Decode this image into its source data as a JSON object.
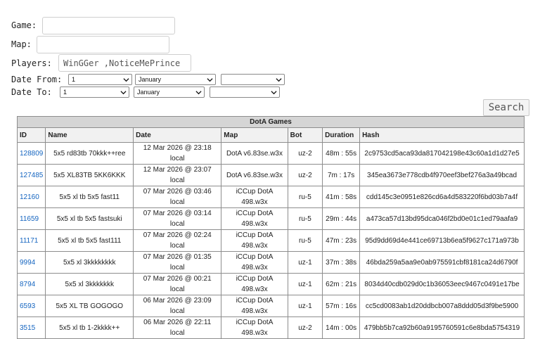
{
  "form": {
    "game_label": "Game:",
    "map_label": "Map:",
    "players_label": "Players:",
    "players_value": "WinGGer ,NoticeMePrince",
    "date_from_label": "Date From:",
    "date_to_label": "Date To:",
    "from_day": "1",
    "from_month": "January",
    "from_year": "",
    "to_day": "1",
    "to_month": "January",
    "to_year": "",
    "search_label": "Search"
  },
  "table": {
    "caption": "DotA Games",
    "headers": [
      "ID",
      "Name",
      "Date",
      "Map",
      "Bot",
      "Duration",
      "Hash"
    ],
    "rows": [
      {
        "id": "128809",
        "name": "5x5 rd83tb 70kkk++ree",
        "date": "12 Mar 2026 @ 23:18 local",
        "map": "DotA v6.83se.w3x",
        "bot": "uz-2",
        "duration": "48m : 55s",
        "hash": "2c9753cd5aca93da817042198e43c60a1d1d27e5"
      },
      {
        "id": "127485",
        "name": "5x5 XL83TB 5KK6KKK",
        "date": "12 Mar 2026 @ 23:07 local",
        "map": "DotA v6.83se.w3x",
        "bot": "uz-2",
        "duration": "7m : 17s",
        "hash": "345ea3673e778cdb4f970eef3bef276a3a49bcad"
      },
      {
        "id": "12160",
        "name": "5x5 xl tb 5x5 fast11",
        "date": "07 Mar 2026 @ 03:46 local",
        "map": "iCCup DotA 498.w3x",
        "bot": "ru-5",
        "duration": "41m : 58s",
        "hash": "cdd145c3e0951e826cd6a4d583220f6bd03b7a4f"
      },
      {
        "id": "11659",
        "name": "5x5 xl tb 5x5 fastsuki",
        "date": "07 Mar 2026 @ 03:14 local",
        "map": "iCCup DotA 498.w3x",
        "bot": "ru-5",
        "duration": "29m : 44s",
        "hash": "a473ca57d13bd95dca046f2bd0e01c1ed79aafa9"
      },
      {
        "id": "11171",
        "name": "5x5 xl tb 5x5 fast111",
        "date": "07 Mar 2026 @ 02:24 local",
        "map": "iCCup DotA 498.w3x",
        "bot": "ru-5",
        "duration": "47m : 23s",
        "hash": "95d9dd69d4e441ce69713b6ea5f9627c171a973b"
      },
      {
        "id": "9994",
        "name": "5x5 xl 3kkkkkkkk",
        "date": "07 Mar 2026 @ 01:35 local",
        "map": "iCCup DotA 498.w3x",
        "bot": "uz-1",
        "duration": "37m : 38s",
        "hash": "46bda259a5aa9e0ab975591cbf8181ca24d6790f"
      },
      {
        "id": "8794",
        "name": "5x5 xl 3kkkkkkk",
        "date": "07 Mar 2026 @ 00:21 local",
        "map": "iCCup DotA 498.w3x",
        "bot": "uz-1",
        "duration": "62m : 21s",
        "hash": "8034d40cdb029d0c1b36053eec9467c0491e17be"
      },
      {
        "id": "6593",
        "name": "5x5 XL TB GOGOGO",
        "date": "06 Mar 2026 @ 23:09 local",
        "map": "iCCup DotA 498.w3x",
        "bot": "uz-1",
        "duration": "57m : 16s",
        "hash": "cc5cd0083ab1d20ddbcb007a8ddd05d3f9be5900"
      },
      {
        "id": "3515",
        "name": "5x5 xl tb 1-2kkkk++",
        "date": "06 Mar 2026 @ 22:11 local",
        "map": "iCCup DotA 498.w3x",
        "bot": "uz-2",
        "duration": "14m : 00s",
        "hash": "479bb5b7ca92b60a9195760591c6e8bda5754319"
      }
    ]
  }
}
